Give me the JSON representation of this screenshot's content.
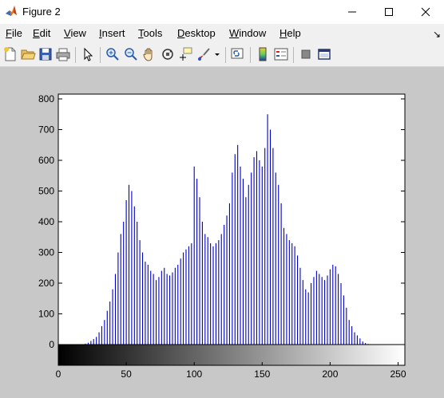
{
  "window": {
    "title": "Figure 2"
  },
  "menu": [
    {
      "label": "File",
      "key": "F",
      "rest": "ile"
    },
    {
      "label": "Edit",
      "key": "E",
      "rest": "dit"
    },
    {
      "label": "View",
      "key": "V",
      "rest": "iew"
    },
    {
      "label": "Insert",
      "key": "I",
      "rest": "nsert"
    },
    {
      "label": "Tools",
      "key": "T",
      "rest": "ools"
    },
    {
      "label": "Desktop",
      "key": "D",
      "rest": "esktop"
    },
    {
      "label": "Window",
      "key": "W",
      "rest": "indow"
    },
    {
      "label": "Help",
      "key": "H",
      "rest": "elp"
    }
  ],
  "toolbar": {
    "icons": [
      "new-figure-icon",
      "open-file-icon",
      "save-icon",
      "print-icon",
      "edit-plot-arrow-icon",
      "zoom-in-icon",
      "zoom-out-icon",
      "pan-hand-icon",
      "rotate-3d-icon",
      "data-cursor-icon",
      "brush-icon",
      "brush-dropdown-icon",
      "link-plot-icon",
      "colorbar-icon",
      "legend-icon",
      "hide-plot-tools-icon",
      "show-plot-tools-icon"
    ]
  },
  "chart_data": {
    "type": "bar",
    "title": "",
    "xlabel": "",
    "ylabel": "",
    "xlim": [
      0,
      255
    ],
    "ylim": [
      0,
      800
    ],
    "yticks": [
      0,
      100,
      200,
      300,
      400,
      500,
      600,
      700,
      800
    ],
    "xticks": [
      0,
      50,
      100,
      150,
      200,
      250
    ],
    "ytick_labels": [
      "0",
      "100",
      "200",
      "300",
      "400",
      "500",
      "600",
      "700",
      "800"
    ],
    "xtick_labels": [
      "0",
      "50",
      "100",
      "150",
      "200",
      "250"
    ],
    "bar_color": "#0000cc",
    "colorbar": "grayscale 0-255",
    "x": [
      0,
      2,
      4,
      6,
      8,
      10,
      12,
      14,
      16,
      18,
      20,
      22,
      24,
      26,
      28,
      30,
      32,
      34,
      36,
      38,
      40,
      42,
      44,
      46,
      48,
      50,
      52,
      54,
      56,
      58,
      60,
      62,
      64,
      66,
      68,
      70,
      72,
      74,
      76,
      78,
      80,
      82,
      84,
      86,
      88,
      90,
      92,
      94,
      96,
      98,
      100,
      102,
      104,
      106,
      108,
      110,
      112,
      114,
      116,
      118,
      120,
      122,
      124,
      126,
      128,
      130,
      132,
      134,
      136,
      138,
      140,
      142,
      144,
      146,
      148,
      150,
      152,
      154,
      156,
      158,
      160,
      162,
      164,
      166,
      168,
      170,
      172,
      174,
      176,
      178,
      180,
      182,
      184,
      186,
      188,
      190,
      192,
      194,
      196,
      198,
      200,
      202,
      204,
      206,
      208,
      210,
      212,
      214,
      216,
      218,
      220,
      222,
      224,
      226,
      228,
      230,
      232,
      234
    ],
    "values": [
      0,
      0,
      0,
      0,
      0,
      0,
      0,
      0,
      0,
      0,
      3,
      6,
      12,
      18,
      25,
      40,
      60,
      80,
      110,
      140,
      180,
      230,
      300,
      360,
      400,
      470,
      520,
      500,
      450,
      400,
      340,
      300,
      270,
      260,
      240,
      230,
      210,
      220,
      240,
      250,
      230,
      225,
      235,
      250,
      260,
      280,
      300,
      310,
      320,
      330,
      580,
      540,
      480,
      400,
      360,
      350,
      330,
      320,
      330,
      340,
      360,
      390,
      420,
      460,
      560,
      620,
      650,
      580,
      540,
      480,
      520,
      560,
      610,
      630,
      600,
      580,
      640,
      750,
      700,
      640,
      560,
      520,
      460,
      380,
      360,
      340,
      330,
      320,
      290,
      250,
      210,
      180,
      170,
      200,
      220,
      240,
      230,
      220,
      210,
      225,
      245,
      260,
      255,
      230,
      200,
      160,
      120,
      80,
      60,
      40,
      30,
      20,
      10,
      5,
      2,
      0,
      0,
      0
    ]
  }
}
